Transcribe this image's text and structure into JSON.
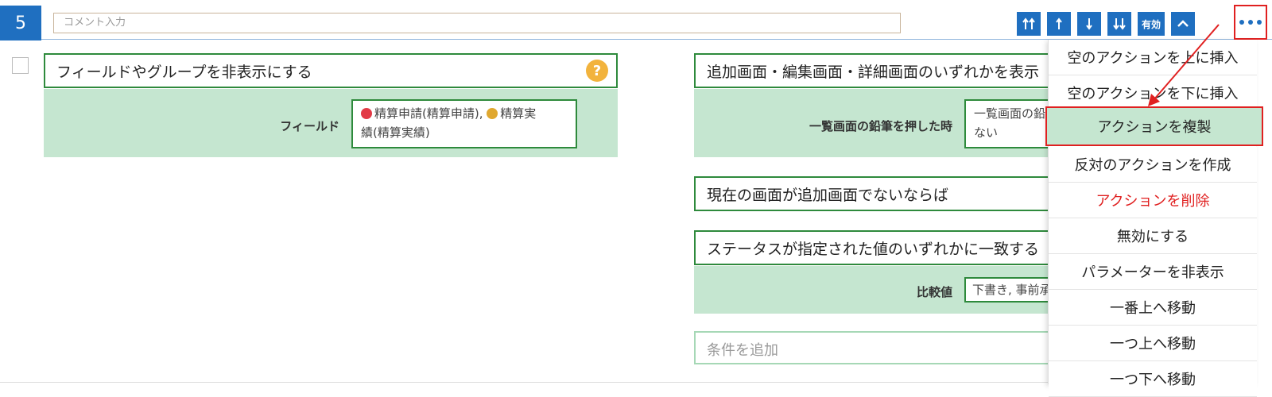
{
  "row": {
    "number": "5",
    "comment_placeholder": "コメント入力"
  },
  "toolbar": {
    "move_top_icon": "double-up-arrow-icon",
    "move_up_icon": "up-arrow-icon",
    "move_down_icon": "down-arrow-icon",
    "move_bottom_icon": "double-down-arrow-icon",
    "enabled_label": "有効",
    "collapse_icon": "chevron-up-icon",
    "more_icon": "ellipsis-icon",
    "accent": "#1f6fc0"
  },
  "left_action": {
    "title": "フィールドやグループを非表示にする",
    "help": "?",
    "field_label": "フィールド",
    "field_value_1": "精算申請(精算申請),",
    "field_value_2": "精算実",
    "field_value_3": "績(精算実績)"
  },
  "right_conditions": {
    "cond1_title": "追加画面・編集画面・詳細画面のいずれかを表示",
    "cond1_label": "一覧画面の鉛筆を押した時",
    "cond1_value_1": "一覧画面の鉛",
    "cond1_value_2": "ない",
    "cond2_title": "現在の画面が追加画面でないならば",
    "cond3_title": "ステータスが指定された値のいずれかに一致する",
    "cond3_label": "比較値",
    "cond3_value": "下書き, 事前承",
    "add_condition": "条件を追加"
  },
  "menu": {
    "items": [
      "空のアクションを上に挿入",
      "空のアクションを下に挿入",
      "アクションを複製",
      "反対のアクションを作成",
      "アクションを削除",
      "無効にする",
      "パラメーターを非表示",
      "一番上へ移動",
      "一つ上へ移動",
      "一つ下へ移動"
    ]
  },
  "colors": {
    "panel": "#c5e6d0",
    "border": "#2e8a3c",
    "highlight": "#e02020"
  }
}
